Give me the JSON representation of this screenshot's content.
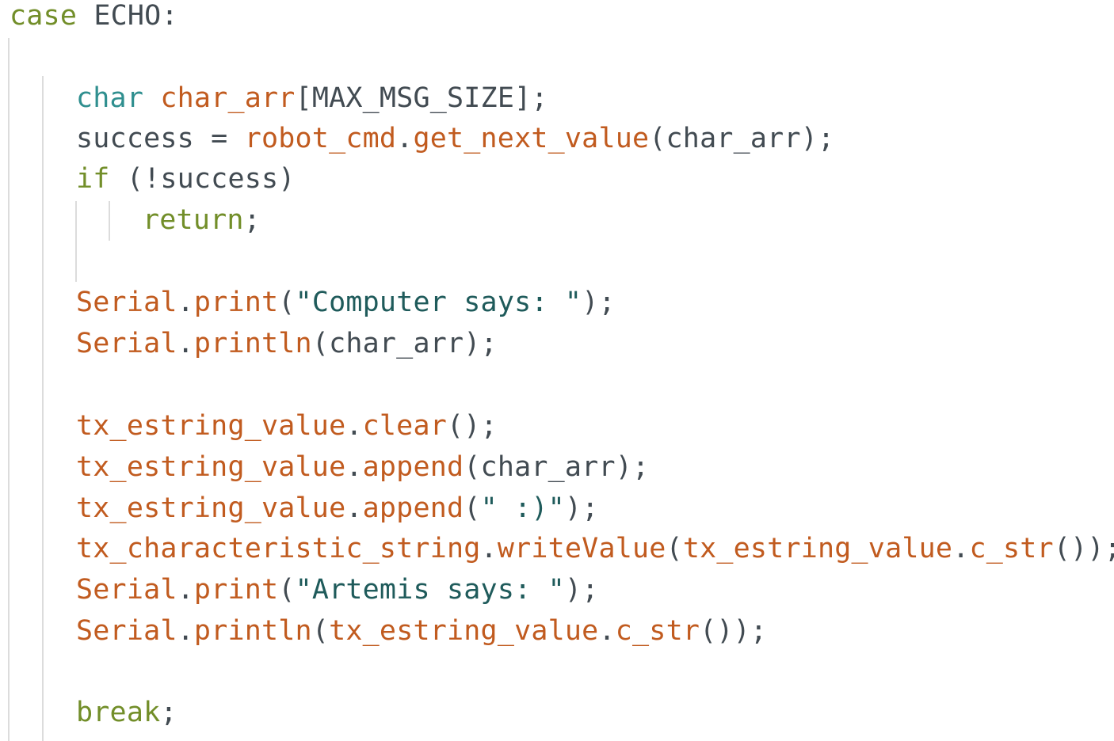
{
  "editor": {
    "language": "C++",
    "colors": {
      "background": "#ffffff",
      "keyword": "#728e29",
      "type": "#2f8f8f",
      "function": "#c15b1f",
      "string": "#1f5b5b",
      "plain": "#424b52",
      "indent_guide": "#dcdcdc"
    },
    "lines": [
      {
        "tokens": [
          {
            "t": "case",
            "k": "kw"
          },
          {
            "t": " ECHO:",
            "k": "plain"
          }
        ]
      },
      {
        "tokens": []
      },
      {
        "tokens": [
          {
            "t": "char",
            "k": "type"
          },
          {
            "t": " ",
            "k": "plain"
          },
          {
            "t": "char_arr",
            "k": "fn"
          },
          {
            "t": "[MAX_MSG_SIZE];",
            "k": "plain"
          }
        ]
      },
      {
        "tokens": [
          {
            "t": "success = ",
            "k": "plain"
          },
          {
            "t": "robot_cmd",
            "k": "fn"
          },
          {
            "t": ".",
            "k": "plain"
          },
          {
            "t": "get_next_value",
            "k": "fn"
          },
          {
            "t": "(char_arr);",
            "k": "plain"
          }
        ]
      },
      {
        "tokens": [
          {
            "t": "if",
            "k": "kw"
          },
          {
            "t": " (!success)",
            "k": "plain"
          }
        ]
      },
      {
        "tokens": [
          {
            "t": "return",
            "k": "kw"
          },
          {
            "t": ";",
            "k": "plain"
          }
        ]
      },
      {
        "tokens": []
      },
      {
        "tokens": [
          {
            "t": "Serial",
            "k": "fn"
          },
          {
            "t": ".",
            "k": "plain"
          },
          {
            "t": "print",
            "k": "fn"
          },
          {
            "t": "(",
            "k": "plain"
          },
          {
            "t": "\"Computer says: \"",
            "k": "str"
          },
          {
            "t": ");",
            "k": "plain"
          }
        ]
      },
      {
        "tokens": [
          {
            "t": "Serial",
            "k": "fn"
          },
          {
            "t": ".",
            "k": "plain"
          },
          {
            "t": "println",
            "k": "fn"
          },
          {
            "t": "(char_arr);",
            "k": "plain"
          }
        ]
      },
      {
        "tokens": []
      },
      {
        "tokens": [
          {
            "t": "tx_estring_value",
            "k": "fn"
          },
          {
            "t": ".",
            "k": "plain"
          },
          {
            "t": "clear",
            "k": "fn"
          },
          {
            "t": "();",
            "k": "plain"
          }
        ]
      },
      {
        "tokens": [
          {
            "t": "tx_estring_value",
            "k": "fn"
          },
          {
            "t": ".",
            "k": "plain"
          },
          {
            "t": "append",
            "k": "fn"
          },
          {
            "t": "(char_arr);",
            "k": "plain"
          }
        ]
      },
      {
        "tokens": [
          {
            "t": "tx_estring_value",
            "k": "fn"
          },
          {
            "t": ".",
            "k": "plain"
          },
          {
            "t": "append",
            "k": "fn"
          },
          {
            "t": "(",
            "k": "plain"
          },
          {
            "t": "\" :)\"",
            "k": "str"
          },
          {
            "t": ");",
            "k": "plain"
          }
        ]
      },
      {
        "tokens": [
          {
            "t": "tx_characteristic_string",
            "k": "fn"
          },
          {
            "t": ".",
            "k": "plain"
          },
          {
            "t": "writeValue",
            "k": "fn"
          },
          {
            "t": "(",
            "k": "plain"
          },
          {
            "t": "tx_estring_value",
            "k": "fn"
          },
          {
            "t": ".",
            "k": "plain"
          },
          {
            "t": "c_str",
            "k": "fn"
          },
          {
            "t": "());",
            "k": "plain"
          }
        ]
      },
      {
        "tokens": [
          {
            "t": "Serial",
            "k": "fn"
          },
          {
            "t": ".",
            "k": "plain"
          },
          {
            "t": "print",
            "k": "fn"
          },
          {
            "t": "(",
            "k": "plain"
          },
          {
            "t": "\"Artemis says: \"",
            "k": "str"
          },
          {
            "t": ");",
            "k": "plain"
          }
        ]
      },
      {
        "tokens": [
          {
            "t": "Serial",
            "k": "fn"
          },
          {
            "t": ".",
            "k": "plain"
          },
          {
            "t": "println",
            "k": "fn"
          },
          {
            "t": "(",
            "k": "plain"
          },
          {
            "t": "tx_estring_value",
            "k": "fn"
          },
          {
            "t": ".",
            "k": "plain"
          },
          {
            "t": "c_str",
            "k": "fn"
          },
          {
            "t": "());",
            "k": "plain"
          }
        ]
      },
      {
        "tokens": []
      },
      {
        "tokens": [
          {
            "t": "break",
            "k": "kw"
          },
          {
            "t": ";",
            "k": "plain"
          }
        ]
      }
    ]
  }
}
